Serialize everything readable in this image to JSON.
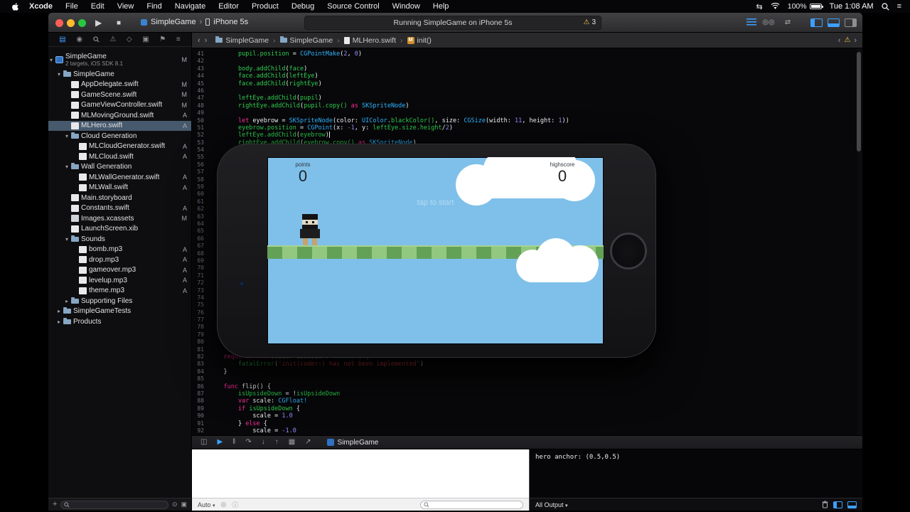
{
  "colors": {
    "accent": "#3da0ff",
    "warning": "#f5c842",
    "selection": "#47596c",
    "sky": "#7fc0ea",
    "ground-light": "#92c87f",
    "ground-dark": "#63a156",
    "keyword": "#ff2d9c",
    "type": "#30b4ff",
    "member": "#2ecc4e",
    "number": "#8f8aff",
    "string": "#ff4a43"
  },
  "menu_bar": {
    "items": [
      "Xcode",
      "File",
      "Edit",
      "View",
      "Find",
      "Navigate",
      "Editor",
      "Product",
      "Debug",
      "Source Control",
      "Window",
      "Help"
    ],
    "battery": "100%",
    "clock": "Tue 1:08 AM"
  },
  "toolbar": {
    "scheme_target": "SimpleGame",
    "scheme_device": "iPhone 5s",
    "status_text": "Running SimpleGame on iPhone 5s",
    "warning_count": "3"
  },
  "navigator_bar": {
    "icons": [
      {
        "name": "project-navigator-icon",
        "glyph": "▤",
        "active": true
      },
      {
        "name": "symbol-navigator-icon",
        "glyph": "◉"
      },
      {
        "name": "find-navigator-icon",
        "glyph": "MAG"
      },
      {
        "name": "issue-navigator-icon",
        "glyph": "⚠"
      },
      {
        "name": "test-navigator-icon",
        "glyph": "◇"
      },
      {
        "name": "debug-navigator-icon",
        "glyph": "▣"
      },
      {
        "name": "breakpoint-navigator-icon",
        "glyph": "⚑"
      },
      {
        "name": "report-navigator-icon",
        "glyph": "≡"
      }
    ]
  },
  "navigator": {
    "items": [
      {
        "kind": "project",
        "label": "SimpleGame",
        "sub": "2 targets, iOS SDK 8.1",
        "badge": "M",
        "level": 0,
        "disc": "open"
      },
      {
        "kind": "folder",
        "label": "SimpleGame",
        "level": 1,
        "disc": "open"
      },
      {
        "kind": "swift",
        "label": "AppDelegate.swift",
        "badge": "M",
        "level": 2
      },
      {
        "kind": "swift",
        "label": "GameScene.swift",
        "badge": "M",
        "level": 2
      },
      {
        "kind": "swift",
        "label": "GameViewController.swift",
        "badge": "M",
        "level": 2
      },
      {
        "kind": "swift",
        "label": "MLMovingGround.swift",
        "badge": "A",
        "level": 2
      },
      {
        "kind": "swift",
        "label": "MLHero.swift",
        "badge": "A",
        "level": 2,
        "selected": true
      },
      {
        "kind": "folder",
        "label": "Cloud Generation",
        "level": 2,
        "disc": "open"
      },
      {
        "kind": "swift",
        "label": "MLCloudGenerator.swift",
        "badge": "A",
        "level": 3
      },
      {
        "kind": "swift",
        "label": "MLCloud.swift",
        "badge": "A",
        "level": 3
      },
      {
        "kind": "folder",
        "label": "Wall Generation",
        "level": 2,
        "disc": "open"
      },
      {
        "kind": "swift",
        "label": "MLWallGenerator.swift",
        "badge": "A",
        "level": 3
      },
      {
        "kind": "swift",
        "label": "MLWall.swift",
        "badge": "A",
        "level": 3
      },
      {
        "kind": "file",
        "label": "Main.storyboard",
        "level": 2
      },
      {
        "kind": "swift",
        "label": "Constants.swift",
        "badge": "A",
        "level": 2
      },
      {
        "kind": "assets",
        "label": "Images.xcassets",
        "badge": "M",
        "level": 2
      },
      {
        "kind": "file",
        "label": "LaunchScreen.xib",
        "level": 2
      },
      {
        "kind": "folder",
        "label": "Sounds",
        "level": 2,
        "disc": "open"
      },
      {
        "kind": "audio",
        "label": "bomb.mp3",
        "badge": "A",
        "level": 3
      },
      {
        "kind": "audio",
        "label": "drop.mp3",
        "badge": "A",
        "level": 3
      },
      {
        "kind": "audio",
        "label": "gameover.mp3",
        "badge": "A",
        "level": 3
      },
      {
        "kind": "audio",
        "label": "levelup.mp3",
        "badge": "A",
        "level": 3
      },
      {
        "kind": "audio",
        "label": "theme.mp3",
        "badge": "A",
        "level": 3
      },
      {
        "kind": "folder",
        "label": "Supporting Files",
        "level": 2,
        "disc": "closed"
      },
      {
        "kind": "folder",
        "label": "SimpleGameTests",
        "level": 1,
        "disc": "closed"
      },
      {
        "kind": "folder",
        "label": "Products",
        "level": 1,
        "disc": "closed"
      }
    ]
  },
  "jump_bar": {
    "back": "‹",
    "forward": "›",
    "segments": [
      {
        "icon": "folder",
        "label": "SimpleGame"
      },
      {
        "icon": "folder",
        "label": "SimpleGame"
      },
      {
        "icon": "swift",
        "label": "MLHero.swift"
      },
      {
        "icon": "method",
        "label": "init()"
      }
    ]
  },
  "editor": {
    "lines": [
      {
        "n": 41,
        "s": [
          [
            "        ",
            "w"
          ],
          [
            "pupil.position",
            "g"
          ],
          [
            " = ",
            "w"
          ],
          [
            "CGPointMake",
            "t"
          ],
          [
            "(",
            "w"
          ],
          [
            "2",
            "n"
          ],
          [
            ", ",
            "w"
          ],
          [
            "0",
            "n"
          ],
          [
            ")",
            "w"
          ]
        ]
      },
      {
        "n": 42,
        "s": []
      },
      {
        "n": 43,
        "s": [
          [
            "        ",
            "w"
          ],
          [
            "body.addChild",
            "g"
          ],
          [
            "(",
            "w"
          ],
          [
            "face",
            "g"
          ],
          [
            ")",
            "w"
          ]
        ]
      },
      {
        "n": 44,
        "s": [
          [
            "        ",
            "w"
          ],
          [
            "face.addChild",
            "g"
          ],
          [
            "(",
            "w"
          ],
          [
            "leftEye",
            "g"
          ],
          [
            ")",
            "w"
          ]
        ]
      },
      {
        "n": 45,
        "s": [
          [
            "        ",
            "w"
          ],
          [
            "face.addChild",
            "g"
          ],
          [
            "(",
            "w"
          ],
          [
            "rightEye",
            "g"
          ],
          [
            ")",
            "w"
          ]
        ]
      },
      {
        "n": 46,
        "s": []
      },
      {
        "n": 47,
        "s": [
          [
            "        ",
            "w"
          ],
          [
            "leftEye.addChild",
            "g"
          ],
          [
            "(",
            "w"
          ],
          [
            "pupil",
            "g"
          ],
          [
            ")",
            "w"
          ]
        ]
      },
      {
        "n": 48,
        "s": [
          [
            "        ",
            "w"
          ],
          [
            "rightEye.addChild",
            "g"
          ],
          [
            "(",
            "w"
          ],
          [
            "pupil.copy()",
            "g"
          ],
          [
            " ",
            "w"
          ],
          [
            "as",
            "k"
          ],
          [
            " ",
            "w"
          ],
          [
            "SKSpriteNode",
            "t"
          ],
          [
            ")",
            "w"
          ]
        ]
      },
      {
        "n": 49,
        "s": []
      },
      {
        "n": 50,
        "s": [
          [
            "        ",
            "w"
          ],
          [
            "let",
            "k"
          ],
          [
            " eyebrow = ",
            "w"
          ],
          [
            "SKSpriteNode",
            "t"
          ],
          [
            "(color: ",
            "w"
          ],
          [
            "UIColor",
            "t"
          ],
          [
            ".",
            "w"
          ],
          [
            "blackColor()",
            "g"
          ],
          [
            ", size: ",
            "w"
          ],
          [
            "CGSize",
            "t"
          ],
          [
            "(width: ",
            "w"
          ],
          [
            "11",
            "n"
          ],
          [
            ", height: ",
            "w"
          ],
          [
            "1",
            "n"
          ],
          [
            "))",
            "w"
          ]
        ]
      },
      {
        "n": 51,
        "s": [
          [
            "        ",
            "w"
          ],
          [
            "eyebrow.position",
            "g"
          ],
          [
            " = ",
            "w"
          ],
          [
            "CGPoint",
            "t"
          ],
          [
            "(x: ",
            "w"
          ],
          [
            "-1",
            "n"
          ],
          [
            ", y: ",
            "w"
          ],
          [
            "leftEye.size.height",
            "g"
          ],
          [
            "/",
            "w"
          ],
          [
            "2",
            "n"
          ],
          [
            ")",
            "w"
          ]
        ]
      },
      {
        "n": 52,
        "s": [
          [
            "        ",
            "w"
          ],
          [
            "leftEye.addChild",
            "g"
          ],
          [
            "(",
            "w"
          ],
          [
            "eyebrow",
            "g"
          ],
          [
            ")",
            "w"
          ]
        ],
        "caret": true
      },
      {
        "n": 53,
        "s": [
          [
            "        ",
            "w"
          ],
          [
            "rightEye.addChild",
            "g"
          ],
          [
            "(",
            "w"
          ],
          [
            "eyebrow.copy()",
            "g"
          ],
          [
            " ",
            "w"
          ],
          [
            "as",
            "k"
          ],
          [
            " ",
            "w"
          ],
          [
            "SKSpriteNode",
            "t"
          ],
          [
            ")",
            "w"
          ]
        ]
      },
      {
        "n": 54,
        "s": []
      },
      {
        "n": 55,
        "s": []
      },
      {
        "n": 56,
        "s": []
      },
      {
        "n": 57,
        "s": []
      },
      {
        "n": 58,
        "s": []
      },
      {
        "n": 59,
        "s": []
      },
      {
        "n": 60,
        "s": []
      },
      {
        "n": 61,
        "s": []
      },
      {
        "n": 62,
        "s": []
      },
      {
        "n": 63,
        "s": []
      },
      {
        "n": 64,
        "s": []
      },
      {
        "n": 65,
        "s": []
      },
      {
        "n": 66,
        "s": []
      },
      {
        "n": 67,
        "s": []
      },
      {
        "n": 68,
        "s": []
      },
      {
        "n": 69,
        "s": []
      },
      {
        "n": 70,
        "s": []
      },
      {
        "n": 71,
        "s": []
      },
      {
        "n": 72,
        "s": []
      },
      {
        "n": 73,
        "s": []
      },
      {
        "n": 74,
        "s": []
      },
      {
        "n": 75,
        "s": []
      },
      {
        "n": 76,
        "s": []
      },
      {
        "n": 77,
        "s": []
      },
      {
        "n": 78,
        "s": []
      },
      {
        "n": 79,
        "s": []
      },
      {
        "n": 80,
        "s": []
      },
      {
        "n": 81,
        "s": []
      },
      {
        "n": 82,
        "s": [
          [
            "    ",
            "w"
          ],
          [
            "required",
            "k"
          ],
          [
            " ",
            "w"
          ],
          [
            "init",
            "k"
          ],
          [
            "(coder aDecoder: ",
            "w"
          ],
          [
            "NSCoder",
            "t"
          ],
          [
            ") {",
            "w"
          ]
        ]
      },
      {
        "n": 83,
        "s": [
          [
            "        ",
            "w"
          ],
          [
            "fatalError",
            "g"
          ],
          [
            "(",
            "w"
          ],
          [
            "\"init(coder:) has not been implemented\"",
            "s"
          ],
          [
            ")",
            "w"
          ]
        ]
      },
      {
        "n": 84,
        "s": [
          [
            "    }",
            "w"
          ]
        ]
      },
      {
        "n": 85,
        "s": []
      },
      {
        "n": 86,
        "s": [
          [
            "    ",
            "w"
          ],
          [
            "func",
            "k"
          ],
          [
            " flip() {",
            "w"
          ]
        ]
      },
      {
        "n": 87,
        "s": [
          [
            "        ",
            "w"
          ],
          [
            "isUpsideDown",
            "g"
          ],
          [
            " = !",
            "w"
          ],
          [
            "isUpsideDown",
            "g"
          ]
        ]
      },
      {
        "n": 88,
        "s": [
          [
            "        ",
            "w"
          ],
          [
            "var",
            "k"
          ],
          [
            " scale: ",
            "w"
          ],
          [
            "CGFloat!",
            "t"
          ]
        ]
      },
      {
        "n": 89,
        "s": [
          [
            "        ",
            "w"
          ],
          [
            "if",
            "k"
          ],
          [
            " ",
            "w"
          ],
          [
            "isUpsideDown",
            "g"
          ],
          [
            " {",
            "w"
          ]
        ]
      },
      {
        "n": 90,
        "s": [
          [
            "            scale = ",
            "w"
          ],
          [
            "1.0",
            "n"
          ]
        ]
      },
      {
        "n": 91,
        "s": [
          [
            "        } ",
            "w"
          ],
          [
            "else",
            "k"
          ],
          [
            " {",
            "w"
          ]
        ]
      },
      {
        "n": 92,
        "s": [
          [
            "            scale = ",
            "w"
          ],
          [
            "-1.0",
            "n"
          ]
        ]
      }
    ]
  },
  "simulator": {
    "points_label": "points",
    "points_value": "0",
    "highscore_label": "highscore",
    "highscore_value": "0",
    "tap_text": "tap to start"
  },
  "debug_toolbar": {
    "icons": [
      {
        "name": "hide-debug-area-button",
        "glyph": "◫"
      },
      {
        "name": "continue-button",
        "glyph": "▶",
        "color": "#35a6ff"
      },
      {
        "name": "pause-button",
        "glyph": "‖"
      },
      {
        "name": "step-over-button",
        "glyph": "↷"
      },
      {
        "name": "step-into-button",
        "glyph": "↓"
      },
      {
        "name": "step-out-button",
        "glyph": "↑"
      },
      {
        "name": "view-hierarchy-button",
        "glyph": "▦"
      },
      {
        "name": "location-button",
        "glyph": "↗"
      }
    ],
    "app_name": "SimpleGame"
  },
  "variables_pane": {
    "scope": "Auto"
  },
  "console_pane": {
    "text": "hero anchor: (0.5,0.5)",
    "scope": "All Output"
  }
}
